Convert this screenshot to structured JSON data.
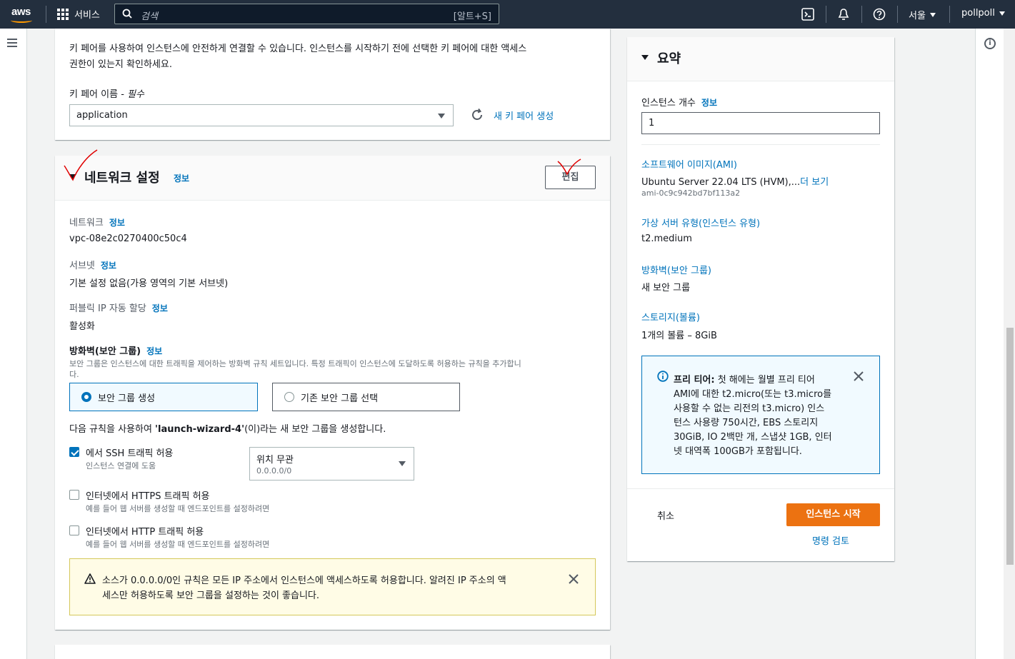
{
  "topnav": {
    "logo": "aws",
    "services_label": "서비스",
    "search_placeholder": "검색",
    "search_shortcut": "[알트+S]",
    "region": "서울",
    "account": "pollpoll"
  },
  "keypair": {
    "description_line1": "키 페어를 사용하여 인스턴스에 안전하게 연결할 수 있습니다. 인스턴스를 시작하기 전에 선택한 키 페어에 대한 액세스",
    "description_line2": "권한이 있는지 확인하세요.",
    "name_label": "키 페어 이름 - ",
    "required": "필수",
    "selected": "application",
    "create_new": "새 키 페어 생성"
  },
  "network": {
    "title": "네트워크 설정",
    "info": "정보",
    "edit_button": "편집",
    "network_label": "네트워크",
    "network_value": "vpc-08e2c0270400c50c4",
    "subnet_label": "서브넷",
    "subnet_value": "기본 설정 없음(가용 영역의 기본 서브넷)",
    "public_ip_label": "퍼블릭 IP 자동 할당",
    "public_ip_value": "활성화",
    "firewall_label": "방화벽(보안 그룹)",
    "firewall_desc_line1": "보안 그룹은 인스턴스에 대한 트래픽을 제어하는 방화벽 규칙 세트입니다. 특정 트래픽이 인스턴스에 도달하도록 허용하는 규칙을 추가합니",
    "firewall_desc_line2": "다.",
    "option_create": "보안 그룹 생성",
    "option_existing": "기존 보안 그룹 선택",
    "rule_text_pre": "다음 규칙을 사용하여 ",
    "rule_text_name": "'launch-wizard-4'",
    "rule_text_post": "(이)라는 새 보안 그룹을 생성합니다.",
    "ssh_label": "에서 SSH 트래픽 허용",
    "ssh_sub": "인스턴스 연결에 도움",
    "ssh_checked": true,
    "source_value": "위치 무관",
    "source_cidr": "0.0.0.0/0",
    "https_label": "인터넷에서 HTTPS 트래픽 허용",
    "https_sub": "예를 들어 웹 서버를 생성할 때 엔드포인트를 설정하려면",
    "http_label": "인터넷에서 HTTP 트래픽 허용",
    "http_sub": "예를 들어 웹 서버를 생성할 때 엔드포인트를 설정하려면",
    "warning_line1": "소스가 0.0.0.0/0인 규칙은 모든 IP 주소에서 인스턴스에 액세스하도록 허용합니다. 알려진 IP 주소의 액",
    "warning_line2": "세스만 허용하도록 보안 그룹을 설정하는 것이 좋습니다."
  },
  "summary": {
    "title": "요약",
    "count_label": "인스턴스 개수",
    "info": "정보",
    "count_value": "1",
    "ami_label": "소프트웨어 이미지(AMI)",
    "ami_value": "Ubuntu Server 22.04 LTS (HVM),...",
    "ami_more": "더 보기",
    "ami_id": "ami-0c9c942bd7bf113a2",
    "type_label": "가상 서버 유형(인스턴스 유형)",
    "type_value": "t2.medium",
    "firewall_label": "방화벽(보안 그룹)",
    "firewall_value": "새 보안 그룹",
    "storage_label": "스토리지(볼륨)",
    "storage_value": "1개의 볼륨 – 8GiB",
    "freetier_title": "프리 티어:",
    "freetier_line1": " 첫 해에는 월별 프리 티어",
    "freetier_line2": "AMI에 대한 t2.micro(또는 t3.micro를",
    "freetier_line3": "사용할 수 없는 리전의 t3.micro) 인스",
    "freetier_line4": "턴스 사용량 750시간, EBS 스토리지",
    "freetier_line5": "30GiB, IO 2백만 개, 스냅샷 1GB, 인터",
    "freetier_line6": "넷 대역폭 100GB가 포함됩니다.",
    "cancel": "취소",
    "launch": "인스턴스 시작",
    "review": "명령 검토"
  },
  "colors": {
    "nav_bg": "#232f3e",
    "accent": "#ec7211",
    "link": "#0073bb",
    "warning_bg": "#fffce6",
    "warning_border": "#d4c85a",
    "info_bg": "#f1faff",
    "info_border": "#0073bb",
    "annotation": "#e00000"
  }
}
